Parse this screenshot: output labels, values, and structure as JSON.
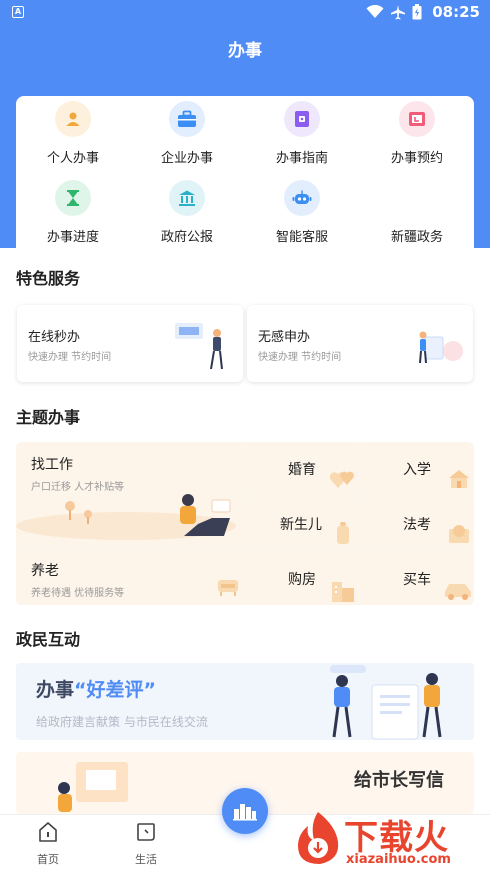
{
  "status_bar": {
    "time": "08:25",
    "indicator": "A"
  },
  "header": {
    "title": "办事"
  },
  "services": [
    {
      "label": "个人办事",
      "icon": "person-icon",
      "color": "#f3a73b",
      "bg": "#fdf1de"
    },
    {
      "label": "企业办事",
      "icon": "briefcase-icon",
      "color": "#3b8ef3",
      "bg": "#e2eefd"
    },
    {
      "label": "办事指南",
      "icon": "guide-book-icon",
      "color": "#8a5cf0",
      "bg": "#efe8fd"
    },
    {
      "label": "办事预约",
      "icon": "calendar-icon",
      "color": "#f05c7a",
      "bg": "#fde6eb"
    },
    {
      "label": "办事进度",
      "icon": "hourglass-icon",
      "color": "#2fb56e",
      "bg": "#e0f5e9"
    },
    {
      "label": "政府公报",
      "icon": "government-building-icon",
      "color": "#2bb0c9",
      "bg": "#e0f4f8"
    },
    {
      "label": "智能客服",
      "icon": "robot-icon",
      "color": "#3b8ef3",
      "bg": "#e2eefd"
    },
    {
      "label": "新疆政务",
      "icon": "",
      "color": "#ffffff",
      "bg": "#ffffff"
    }
  ],
  "featured": {
    "title": "特色服务",
    "cards": [
      {
        "title": "在线秒办",
        "subtitle": "快速办理 节约时间"
      },
      {
        "title": "无感申办",
        "subtitle": "快速办理 节约时间"
      }
    ]
  },
  "topics": {
    "title": "主题办事",
    "find_job": {
      "label": "找工作",
      "subtitle": "户口迁移 人才补贴等"
    },
    "elderly": {
      "label": "养老",
      "subtitle": "养老待遇 优待服务等"
    },
    "small": [
      "婚育",
      "入学",
      "新生儿",
      "法考",
      "购房",
      "买车"
    ]
  },
  "interaction": {
    "title": "政民互动",
    "banner1": {
      "title_a": "办事",
      "title_b": "“好差评”",
      "subtitle": "给政府建言献策 与市民在线交流"
    },
    "banner2": {
      "title": "给市长写信"
    }
  },
  "bottom_nav": {
    "home": "首页",
    "life": "生活"
  },
  "watermark": {
    "text": "下载火",
    "url": "xiazaihuo.com"
  },
  "colors": {
    "primary": "#4f8cf6",
    "accent_orange": "#f3a73b"
  }
}
